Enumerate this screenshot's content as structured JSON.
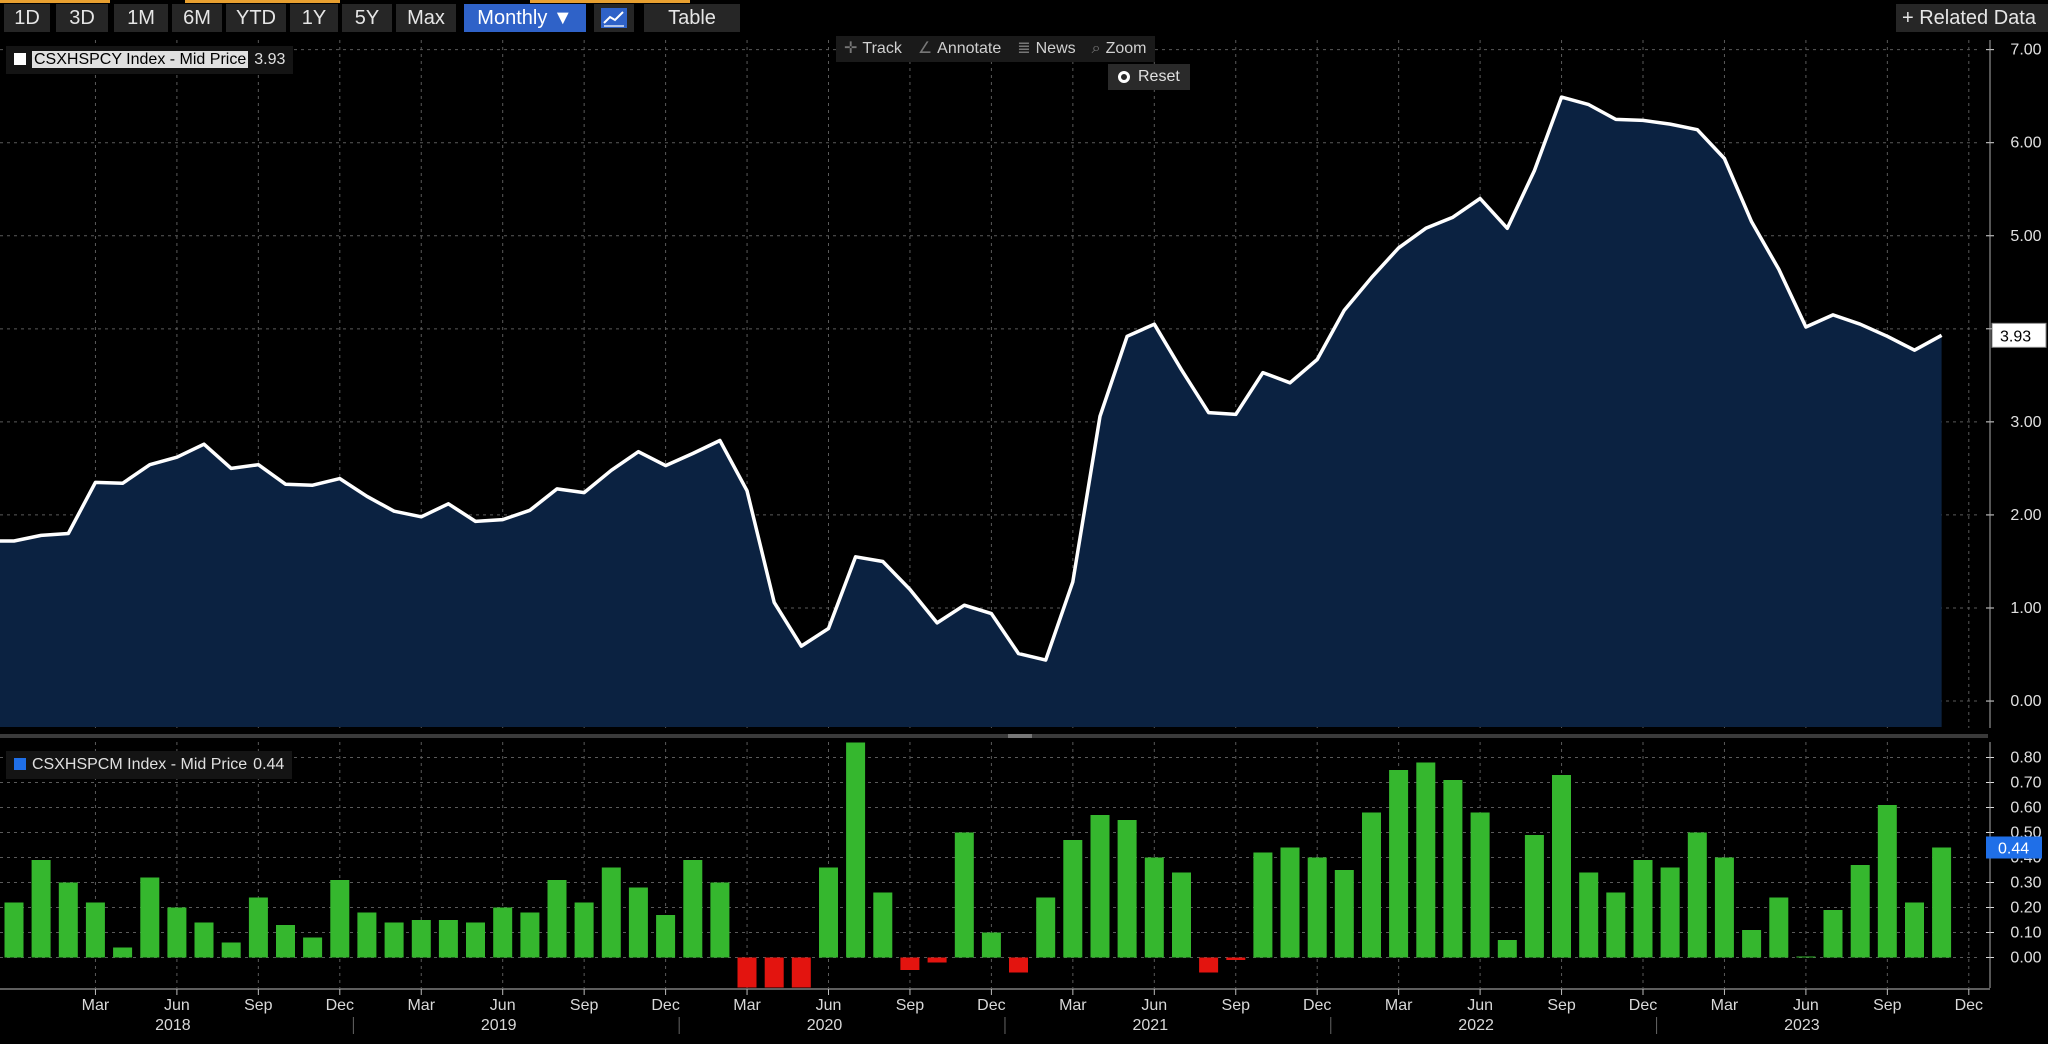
{
  "toolbar": {
    "buttons": [
      "1D",
      "3D",
      "1M",
      "6M",
      "YTD",
      "1Y",
      "5Y",
      "Max"
    ],
    "frequency": "Monthly ▼",
    "chart_type_icon": "line-chart-icon",
    "table_label": "Table",
    "related_label": "+ Related Data"
  },
  "chart_tools": {
    "track": "Track",
    "annotate": "Annotate",
    "news": "News",
    "zoom": "Zoom",
    "reset": "Reset"
  },
  "colors": {
    "background": "#000000",
    "line": "#ffffff",
    "area_fill": "#0b2241",
    "bar_positive": "#35b72e",
    "bar_negative": "#e3140f",
    "grid": "#5a5a5a",
    "selected_button": "#2f62c8",
    "legend_bottom_swatch": "#1f6fe8"
  },
  "chart_data": [
    {
      "type": "area",
      "legend": "CSXHSPCY Index - Mid Price",
      "last_value": "3.93",
      "last_value_label": "3.93",
      "ylim": [
        -0.15,
        7.05
      ],
      "y_ticks": [
        "0.00",
        "1.00",
        "2.00",
        "3.00",
        "4.00",
        "5.00",
        "6.00",
        "7.00"
      ],
      "x_start": "2017-12",
      "x": [
        "2017-12",
        "2018-01",
        "2018-02",
        "2018-03",
        "2018-04",
        "2018-05",
        "2018-06",
        "2018-07",
        "2018-08",
        "2018-09",
        "2018-10",
        "2018-11",
        "2018-12",
        "2019-01",
        "2019-02",
        "2019-03",
        "2019-04",
        "2019-05",
        "2019-06",
        "2019-07",
        "2019-08",
        "2019-09",
        "2019-10",
        "2019-11",
        "2019-12",
        "2020-01",
        "2020-02",
        "2020-03",
        "2020-04",
        "2020-05",
        "2020-06",
        "2020-07",
        "2020-08",
        "2020-09",
        "2020-10",
        "2020-11",
        "2020-12",
        "2021-01",
        "2021-02",
        "2021-03",
        "2021-04",
        "2021-05",
        "2021-06",
        "2021-07",
        "2021-08",
        "2021-09",
        "2021-10",
        "2021-11",
        "2021-12",
        "2022-01",
        "2022-02",
        "2022-03",
        "2022-04",
        "2022-05",
        "2022-06",
        "2022-07",
        "2022-08",
        "2022-09",
        "2022-10",
        "2022-11",
        "2022-12",
        "2023-01",
        "2023-02",
        "2023-03",
        "2023-04",
        "2023-05",
        "2023-06",
        "2023-07",
        "2023-08",
        "2023-09",
        "2023-10",
        "2023-11"
      ],
      "values": [
        1.72,
        1.78,
        1.8,
        2.35,
        2.34,
        2.54,
        2.62,
        2.76,
        2.5,
        2.54,
        2.33,
        2.32,
        2.39,
        2.2,
        2.04,
        1.98,
        2.12,
        1.93,
        1.95,
        2.05,
        2.28,
        2.24,
        2.48,
        2.68,
        2.53,
        2.66,
        2.8,
        2.26,
        1.06,
        0.59,
        0.78,
        1.55,
        1.5,
        1.2,
        0.84,
        1.03,
        0.94,
        0.51,
        0.44,
        1.28,
        3.06,
        3.92,
        4.05,
        3.56,
        3.1,
        3.08,
        3.53,
        3.42,
        3.67,
        4.2,
        4.55,
        4.87,
        5.08,
        5.2,
        5.4,
        5.08,
        5.7,
        6.49,
        6.41,
        6.25,
        6.24,
        6.2,
        6.14,
        5.83,
        5.15,
        4.64,
        4.02,
        4.15,
        4.05,
        3.92,
        3.77,
        3.93
      ]
    },
    {
      "type": "bar",
      "legend": "CSXHSPCM Index - Mid Price",
      "last_value": "0.44",
      "last_value_label": "0.44",
      "ylim": [
        -0.11,
        0.87
      ],
      "y_ticks": [
        "0.00",
        "0.10",
        "0.20",
        "0.30",
        "0.40",
        "0.50",
        "0.60",
        "0.70",
        "0.80"
      ],
      "x": [
        "2017-12",
        "2018-01",
        "2018-02",
        "2018-03",
        "2018-04",
        "2018-05",
        "2018-06",
        "2018-07",
        "2018-08",
        "2018-09",
        "2018-10",
        "2018-11",
        "2018-12",
        "2019-01",
        "2019-02",
        "2019-03",
        "2019-04",
        "2019-05",
        "2019-06",
        "2019-07",
        "2019-08",
        "2019-09",
        "2019-10",
        "2019-11",
        "2019-12",
        "2020-01",
        "2020-02",
        "2020-03",
        "2020-04",
        "2020-05",
        "2020-06",
        "2020-07",
        "2020-08",
        "2020-09",
        "2020-10",
        "2020-11",
        "2020-12",
        "2021-01",
        "2021-02",
        "2021-03",
        "2021-04",
        "2021-05",
        "2021-06",
        "2021-07",
        "2021-08",
        "2021-09",
        "2021-10",
        "2021-11",
        "2021-12",
        "2022-01",
        "2022-02",
        "2022-03",
        "2022-04",
        "2022-05",
        "2022-06",
        "2022-07",
        "2022-08",
        "2022-09",
        "2022-10",
        "2022-11",
        "2022-12",
        "2023-01",
        "2023-02",
        "2023-03",
        "2023-04",
        "2023-05",
        "2023-06",
        "2023-07",
        "2023-08",
        "2023-09",
        "2023-10",
        "2023-11"
      ],
      "values": [
        0.22,
        0.39,
        0.3,
        0.22,
        0.04,
        0.32,
        0.2,
        0.14,
        0.06,
        0.24,
        0.13,
        0.08,
        0.31,
        0.18,
        0.14,
        0.15,
        0.15,
        0.14,
        0.2,
        0.18,
        0.31,
        0.22,
        0.36,
        0.28,
        0.17,
        0.39,
        0.3,
        -0.12,
        -0.12,
        -0.12,
        0.36,
        0.86,
        0.26,
        -0.05,
        -0.02,
        0.5,
        0.1,
        -0.06,
        0.24,
        0.47,
        0.57,
        0.55,
        0.4,
        0.34,
        -0.06,
        -0.01,
        0.42,
        0.44,
        0.4,
        0.35,
        0.58,
        0.75,
        0.78,
        0.71,
        0.58,
        0.07,
        0.49,
        0.73,
        0.34,
        0.26,
        0.39,
        0.36,
        0.5,
        0.4,
        0.11,
        0.24,
        0.0,
        0.19,
        0.37,
        0.61,
        0.22,
        0.44
      ]
    }
  ],
  "x_axis": {
    "month_ticks": [
      {
        "label": "Mar",
        "x": "2018-03"
      },
      {
        "label": "Jun",
        "x": "2018-06"
      },
      {
        "label": "Sep",
        "x": "2018-09"
      },
      {
        "label": "Dec",
        "x": "2018-12"
      },
      {
        "label": "Mar",
        "x": "2019-03"
      },
      {
        "label": "Jun",
        "x": "2019-06"
      },
      {
        "label": "Sep",
        "x": "2019-09"
      },
      {
        "label": "Dec",
        "x": "2019-12"
      },
      {
        "label": "Mar",
        "x": "2020-03"
      },
      {
        "label": "Jun",
        "x": "2020-06"
      },
      {
        "label": "Sep",
        "x": "2020-09"
      },
      {
        "label": "Dec",
        "x": "2020-12"
      },
      {
        "label": "Mar",
        "x": "2021-03"
      },
      {
        "label": "Jun",
        "x": "2021-06"
      },
      {
        "label": "Sep",
        "x": "2021-09"
      },
      {
        "label": "Dec",
        "x": "2021-12"
      },
      {
        "label": "Mar",
        "x": "2022-03"
      },
      {
        "label": "Jun",
        "x": "2022-06"
      },
      {
        "label": "Sep",
        "x": "2022-09"
      },
      {
        "label": "Dec",
        "x": "2022-12"
      },
      {
        "label": "Mar",
        "x": "2023-03"
      },
      {
        "label": "Jun",
        "x": "2023-06"
      },
      {
        "label": "Sep",
        "x": "2023-09"
      },
      {
        "label": "Dec",
        "x": "2023-12"
      }
    ],
    "years": [
      {
        "label": "2018",
        "x": "2018-06"
      },
      {
        "label": "2019",
        "x": "2019-06"
      },
      {
        "label": "2020",
        "x": "2020-06"
      },
      {
        "label": "2021",
        "x": "2021-06"
      },
      {
        "label": "2022",
        "x": "2022-06"
      },
      {
        "label": "2023",
        "x": "2023-06"
      }
    ]
  }
}
